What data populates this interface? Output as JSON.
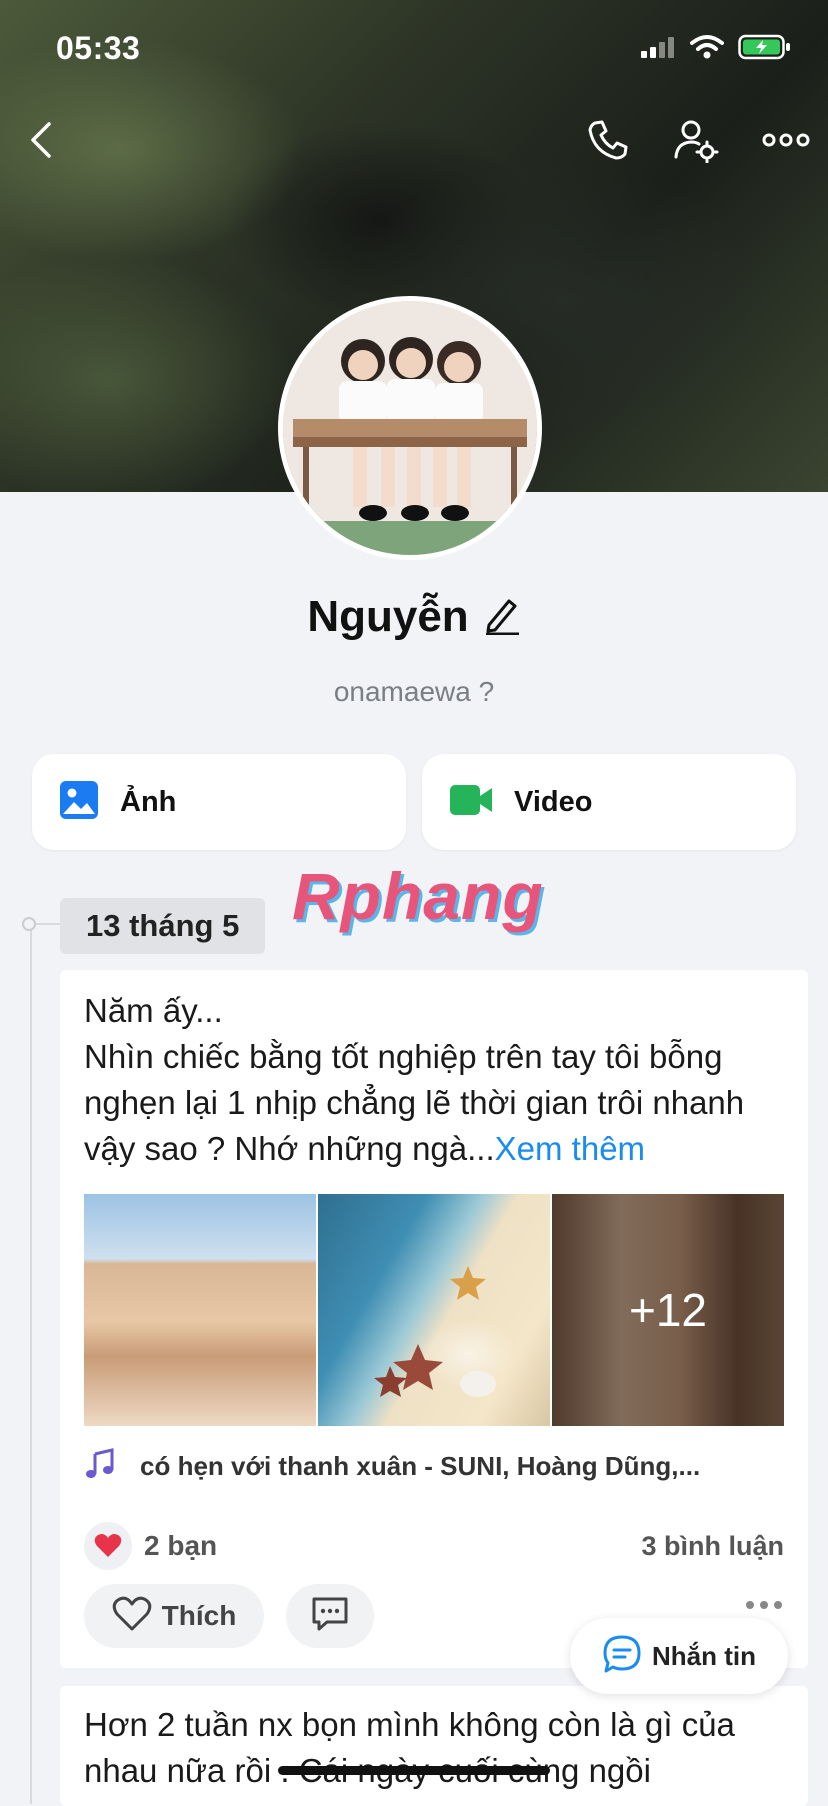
{
  "status_bar": {
    "time": "05:33"
  },
  "profile": {
    "name": "Nguyễn",
    "bio": "onamaewa ?"
  },
  "media_tabs": [
    {
      "label": "Ảnh",
      "icon": "photo-icon",
      "color": "#1a7cf0"
    },
    {
      "label": "Video",
      "icon": "video-icon",
      "color": "#26b45a"
    }
  ],
  "watermark": "Rphang",
  "timeline": {
    "date": "13 tháng 5",
    "posts": [
      {
        "text": "Năm ấy...\nNhìn chiếc bằng tốt nghiệp trên tay tôi bỗng nghẹn lại 1 nhịp chẳng lẽ thời gian trôi nhanh vậy sao ? Nhớ những ngà...",
        "more_label": "Xem thêm",
        "extra_photos": "+12",
        "song": "có hẹn với thanh xuân - SUNI, Hoàng Dũng,...",
        "reactions": "2 bạn",
        "comments": "3 bình luận",
        "like_label": "Thích"
      },
      {
        "text": "Hơn 2 tuần nx bọn mình không còn là gì của nhau nữa rồi . Cái ngày cuối cùng ngồi"
      }
    ]
  },
  "chat_button": {
    "label": "Nhắn tin"
  },
  "colors": {
    "accent": "#1a8cf0",
    "heart": "#e8344a",
    "music": "#6a5acd"
  }
}
